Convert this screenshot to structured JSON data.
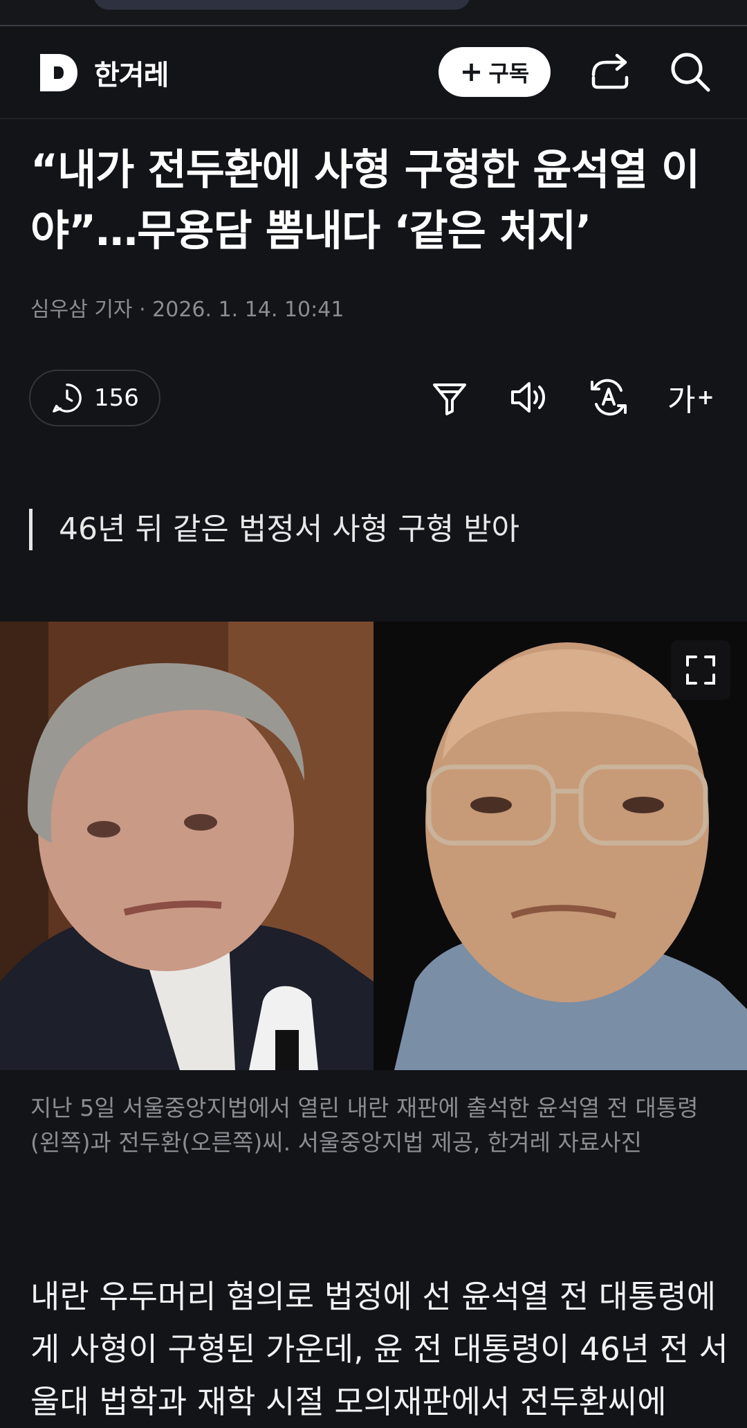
{
  "header": {
    "logo_letter": "D",
    "logo_text": "한겨레",
    "subscribe_plus": "+",
    "subscribe_label": "구독"
  },
  "article": {
    "title": "“내가 전두환에 사형 구형한 윤석열 이야”…무용담 뽐내다 ‘같은 처지’",
    "byline": "심우삼 기자 · 2026. 1. 14. 10:41",
    "comment_count": "156",
    "font_tool_label": "가",
    "font_tool_sup": "+",
    "subheading": "46년 뒤 같은 법정서 사형 구형 받아",
    "photo_caption": "지난 5일 서울중앙지법에서 열린 내란 재판에 출석한 윤석열 전 대통령(왼쪽)과 전두환(오른쪽)씨. 서울중앙지법 제공, 한겨레 자료사진",
    "body": "내란 우두머리 혐의로 법정에 선 윤석열 전 대통령에게 사형이 구형된 가운데, 윤 전 대통령이 46년 전 서울대 법학과 재학 시절 모의재판에서 전두환씨에"
  },
  "colors": {
    "background": "#131418",
    "text": "#ffffff",
    "meta": "#8b8d93",
    "button_bg": "#ffffff"
  }
}
